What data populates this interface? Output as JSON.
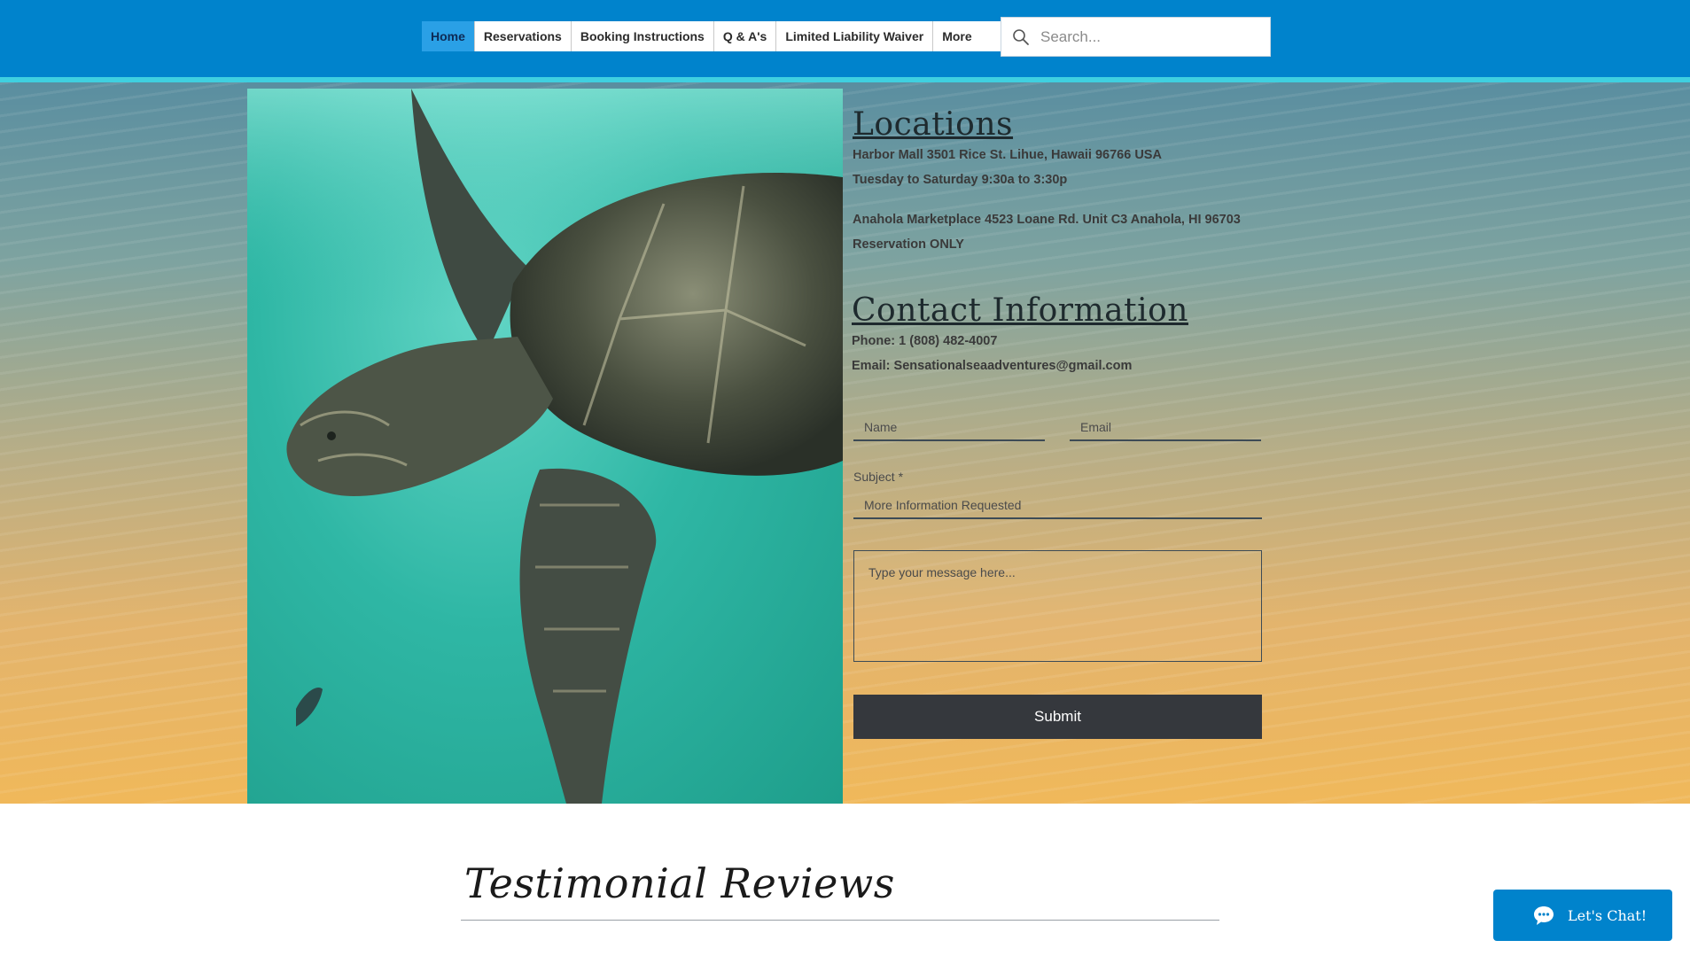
{
  "nav": {
    "items": [
      {
        "label": "Home"
      },
      {
        "label": "Reservations"
      },
      {
        "label": "Booking Instructions"
      },
      {
        "label": "Q & A's"
      },
      {
        "label": "Limited Liability Waiver"
      },
      {
        "label": "More"
      }
    ],
    "active": "Home"
  },
  "search": {
    "placeholder": "Search...",
    "icon": "search-icon"
  },
  "locations": {
    "heading": "Locations",
    "lines": [
      "Harbor Mall 3501 Rice St. Lihue, Hawaii 96766 USA",
      "Tuesday to Saturday 9:30a to 3:30p",
      "Anahola Marketplace 4523 Loane Rd. Unit C3 Anahola, HI 96703",
      "Reservation ONLY"
    ]
  },
  "contact": {
    "heading": "Contact Information",
    "phone": "Phone: 1 (808) 482-4007",
    "email": "Email: Sensationalseaadventures@gmail.com"
  },
  "form": {
    "name_placeholder": "Name",
    "email_placeholder": "Email",
    "subject_label": "Subject *",
    "subject_value": "More Information Requested",
    "message_placeholder": "Type your message here...",
    "submit_label": "Submit"
  },
  "testimonials": {
    "title": "Testimonial Reviews"
  },
  "chat": {
    "label": "Let's Chat!",
    "icon": "chat-bubble-icon"
  },
  "colors": {
    "header": "#0083cc",
    "header_stripe": "#3fd0e0",
    "nav_active": "#2aa0e6",
    "submit_bg": "#35383d",
    "chat_bg": "#0083cc"
  }
}
